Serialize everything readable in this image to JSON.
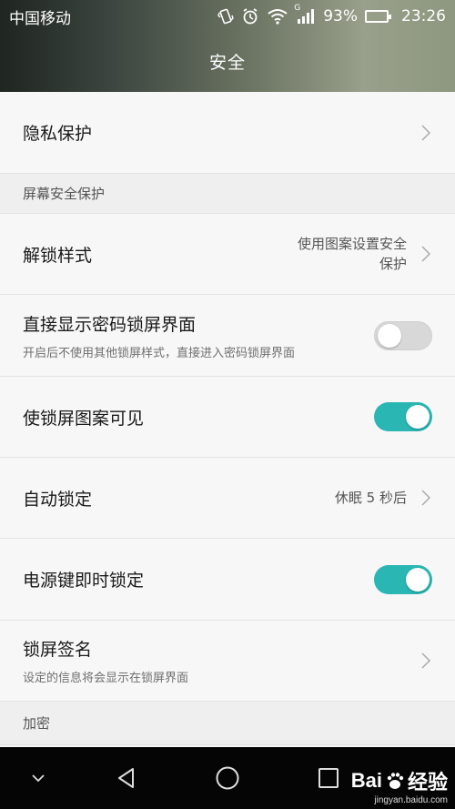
{
  "status": {
    "carrier": "中国移动",
    "battery_percent": "93%",
    "battery_level": 0.93,
    "time": "23:26",
    "network": "G"
  },
  "header": {
    "title": "安全"
  },
  "rows": {
    "privacy": {
      "title": "隐私保护"
    },
    "section_screen": "屏幕安全保护",
    "unlock_style": {
      "title": "解锁样式",
      "value_line1": "使用图案设置安全",
      "value_line2": "保护"
    },
    "direct_pwd": {
      "title": "直接显示密码锁屏界面",
      "sub": "开启后不使用其他锁屏样式，直接进入密码锁屏界面",
      "state": "off"
    },
    "pattern_visible": {
      "title": "使锁屏图案可见",
      "state": "on"
    },
    "auto_lock": {
      "title": "自动锁定",
      "value": "休眠 5 秒后"
    },
    "power_lock": {
      "title": "电源键即时锁定",
      "state": "on"
    },
    "signature": {
      "title": "锁屏签名",
      "sub": "设定的信息将会显示在锁屏界面"
    },
    "section_encrypt": "加密"
  },
  "watermark": {
    "brand_a": "Bai",
    "brand_b": "经验",
    "url": "jingyan.baidu.com"
  },
  "colors": {
    "accent": "#2ab6b3",
    "navbar": "#050505"
  }
}
